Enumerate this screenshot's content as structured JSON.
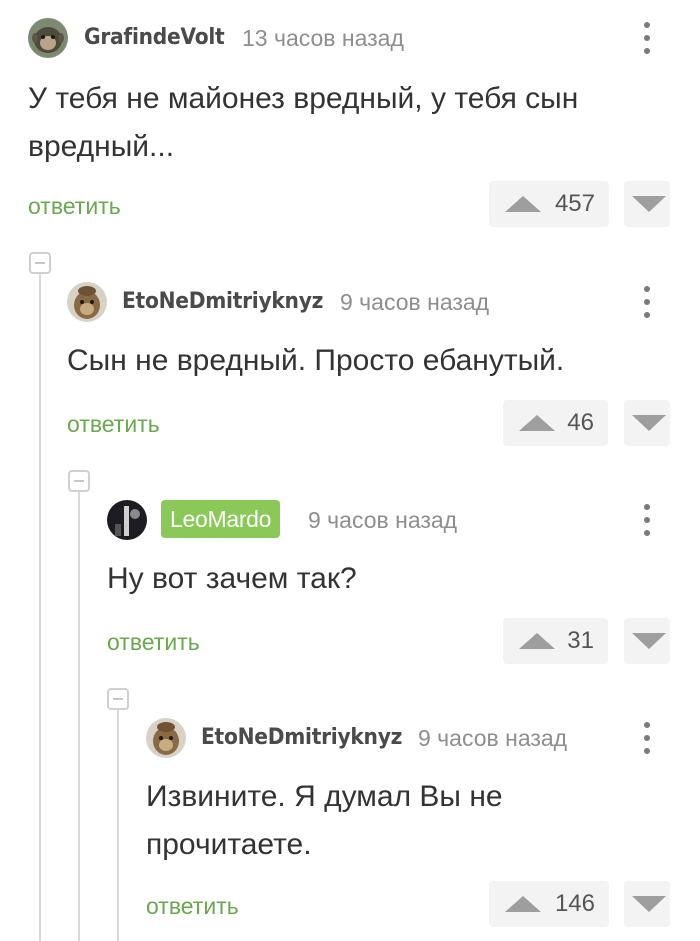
{
  "comments": [
    {
      "username": "GrafindeVolt",
      "time": "13 часов назад",
      "text": "У тебя не майонез вредный, у тебя сын вредный...",
      "reply_label": "ответить",
      "votes": "457",
      "avatar_icon": "monkey-avatar-icon"
    },
    {
      "username": "EtoNeDmitriyknyz",
      "time": "9 часов назад",
      "text": "Сын не вредный. Просто ебанутый.",
      "reply_label": "ответить",
      "votes": "46",
      "avatar_icon": "monkey-avatar-icon"
    },
    {
      "username": "LeoMardo",
      "time": "9 часов назад",
      "text": "Ну вот зачем так?",
      "reply_label": "ответить",
      "votes": "31",
      "avatar_icon": "dark-avatar-icon"
    },
    {
      "username": "EtoNeDmitriyknyz",
      "time": "9 часов назад",
      "text": "Извините. Я думал Вы не прочитаете.",
      "reply_label": "ответить",
      "votes": "146",
      "avatar_icon": "monkey-avatar-icon"
    }
  ],
  "colors": {
    "reply_green": "#6aa84f",
    "badge_green": "#8ac858",
    "vote_bg": "#f3f3f3",
    "thread_line": "#d9d9d9"
  }
}
